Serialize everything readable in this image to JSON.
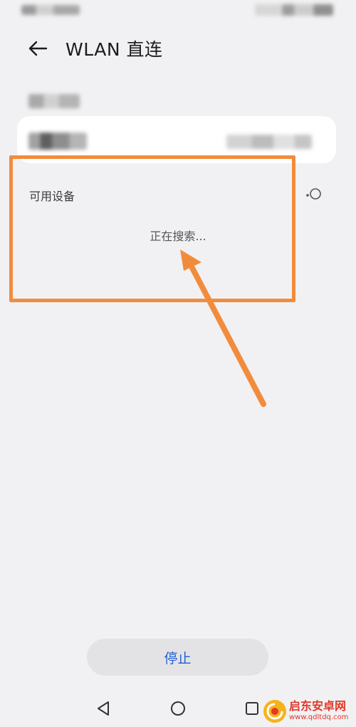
{
  "header": {
    "title": "WLAN 直连"
  },
  "available": {
    "section_title": "可用设备",
    "searching_text": "正在搜索..."
  },
  "footer": {
    "stop_label": "停止"
  },
  "watermark": {
    "title": "启东安卓网",
    "url": "www.qdltdq.com"
  },
  "colors": {
    "accent": "#1f5fd6",
    "annotation": "#f28c3d",
    "background": "#f1f1f3"
  },
  "icons": {
    "back": "arrow-left-icon",
    "spinner": "loading-spinner-icon",
    "nav_back": "triangle-back-icon",
    "nav_home": "circle-home-icon",
    "nav_recent": "square-recent-icon"
  }
}
